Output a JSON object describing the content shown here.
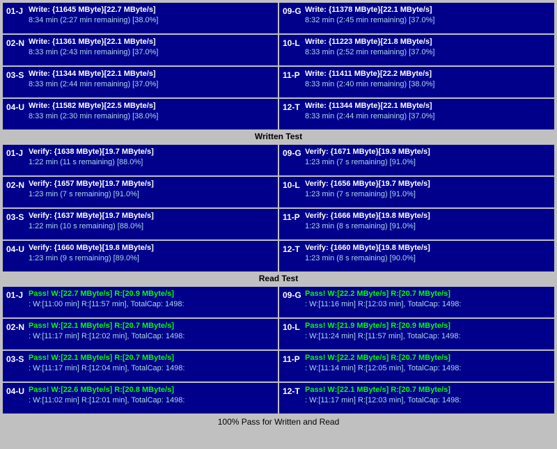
{
  "sections": {
    "write": {
      "label": "Written Test",
      "cells": [
        {
          "id": "01-J",
          "col": "left",
          "line1": "Write: {11645 MByte}[22.7 MByte/s]",
          "line2": "8:34 min (2:27 min remaining)  [38.0%]"
        },
        {
          "id": "09-G",
          "col": "right",
          "line1": "Write: {11378 MByte}[22.1 MByte/s]",
          "line2": "8:32 min (2:45 min remaining)  [37.0%]"
        },
        {
          "id": "02-N",
          "col": "left",
          "line1": "Write: {11361 MByte}[22.1 MByte/s]",
          "line2": "8:33 min (2:43 min remaining)  [37.0%]"
        },
        {
          "id": "10-L",
          "col": "right",
          "line1": "Write: {11223 MByte}[21.8 MByte/s]",
          "line2": "8:33 min (2:52 min remaining)  [37.0%]"
        },
        {
          "id": "03-S",
          "col": "left",
          "line1": "Write: {11344 MByte}[22.1 MByte/s]",
          "line2": "8:33 min (2:44 min remaining)  [37.0%]"
        },
        {
          "id": "11-P",
          "col": "right",
          "line1": "Write: {11411 MByte}[22.2 MByte/s]",
          "line2": "8:33 min (2:40 min remaining)  [38.0%]"
        },
        {
          "id": "04-U",
          "col": "left",
          "line1": "Write: {11582 MByte}[22.5 MByte/s]",
          "line2": "8:33 min (2:30 min remaining)  [38.0%]"
        },
        {
          "id": "12-T",
          "col": "right",
          "line1": "Write: {11344 MByte}[22.1 MByte/s]",
          "line2": "8:33 min (2:44 min remaining)  [37.0%]"
        }
      ]
    },
    "verify": {
      "label": "Written Test",
      "cells": [
        {
          "id": "01-J",
          "col": "left",
          "line1": "Verify: {1638 MByte}[19.7 MByte/s]",
          "line2": "1:22 min (11 s remaining)  [88.0%]"
        },
        {
          "id": "09-G",
          "col": "right",
          "line1": "Verify: {1671 MByte}[19.9 MByte/s]",
          "line2": "1:23 min (7 s remaining)  [91.0%]"
        },
        {
          "id": "02-N",
          "col": "left",
          "line1": "Verify: {1657 MByte}[19.7 MByte/s]",
          "line2": "1:23 min (7 s remaining)  [91.0%]"
        },
        {
          "id": "10-L",
          "col": "right",
          "line1": "Verify: {1656 MByte}[19.7 MByte/s]",
          "line2": "1:23 min (7 s remaining)  [91.0%]"
        },
        {
          "id": "03-S",
          "col": "left",
          "line1": "Verify: {1637 MByte}[19.7 MByte/s]",
          "line2": "1:22 min (10 s remaining)  [88.0%]"
        },
        {
          "id": "11-P",
          "col": "right",
          "line1": "Verify: {1666 MByte}[19.8 MByte/s]",
          "line2": "1:23 min (8 s remaining)  [91.0%]"
        },
        {
          "id": "04-U",
          "col": "left",
          "line1": "Verify: {1660 MByte}[19.8 MByte/s]",
          "line2": "1:23 min (9 s remaining)  [89.0%]"
        },
        {
          "id": "12-T",
          "col": "right",
          "line1": "Verify: {1660 MByte}[19.8 MByte/s]",
          "line2": "1:23 min (8 s remaining)  [90.0%]"
        }
      ]
    },
    "read": {
      "label": "Read Test",
      "cells": [
        {
          "id": "01-J",
          "col": "left",
          "pass": true,
          "line1": "Pass! W:[22.7 MByte/s] R:[20.9 MByte/s]",
          "line2": ": W:[11:00 min] R:[11:57 min], TotalCap: 1498:"
        },
        {
          "id": "09-G",
          "col": "right",
          "pass": true,
          "line1": "Pass! W:[22.2 MByte/s] R:[20.7 MByte/s]",
          "line2": ": W:[11:16 min] R:[12:03 min], TotalCap: 1498:"
        },
        {
          "id": "02-N",
          "col": "left",
          "pass": true,
          "line1": "Pass! W:[22.1 MByte/s] R:[20.7 MByte/s]",
          "line2": ": W:[11:17 min] R:[12:02 min], TotalCap: 1498:"
        },
        {
          "id": "10-L",
          "col": "right",
          "pass": true,
          "line1": "Pass! W:[21.9 MByte/s] R:[20.9 MByte/s]",
          "line2": ": W:[11:24 min] R:[11:57 min], TotalCap: 1498:"
        },
        {
          "id": "03-S",
          "col": "left",
          "pass": true,
          "line1": "Pass! W:[22.1 MByte/s] R:[20.7 MByte/s]",
          "line2": ": W:[11:17 min] R:[12:04 min], TotalCap: 1498:"
        },
        {
          "id": "11-P",
          "col": "right",
          "pass": true,
          "line1": "Pass! W:[22.2 MByte/s] R:[20.7 MByte/s]",
          "line2": ": W:[11:14 min] R:[12:05 min], TotalCap: 1498:"
        },
        {
          "id": "04-U",
          "col": "left",
          "pass": true,
          "line1": "Pass! W:[22.6 MByte/s] R:[20.8 MByte/s]",
          "line2": ": W:[11:02 min] R:[12:01 min], TotalCap: 1498:"
        },
        {
          "id": "12-T",
          "col": "right",
          "pass": true,
          "line1": "Pass! W:[22.1 MByte/s] R:[20.7 MByte/s]",
          "line2": ": W:[11:17 min] R:[12:03 min], TotalCap: 1498:"
        }
      ]
    }
  },
  "bottom_label": "100% Pass for Written and Read"
}
